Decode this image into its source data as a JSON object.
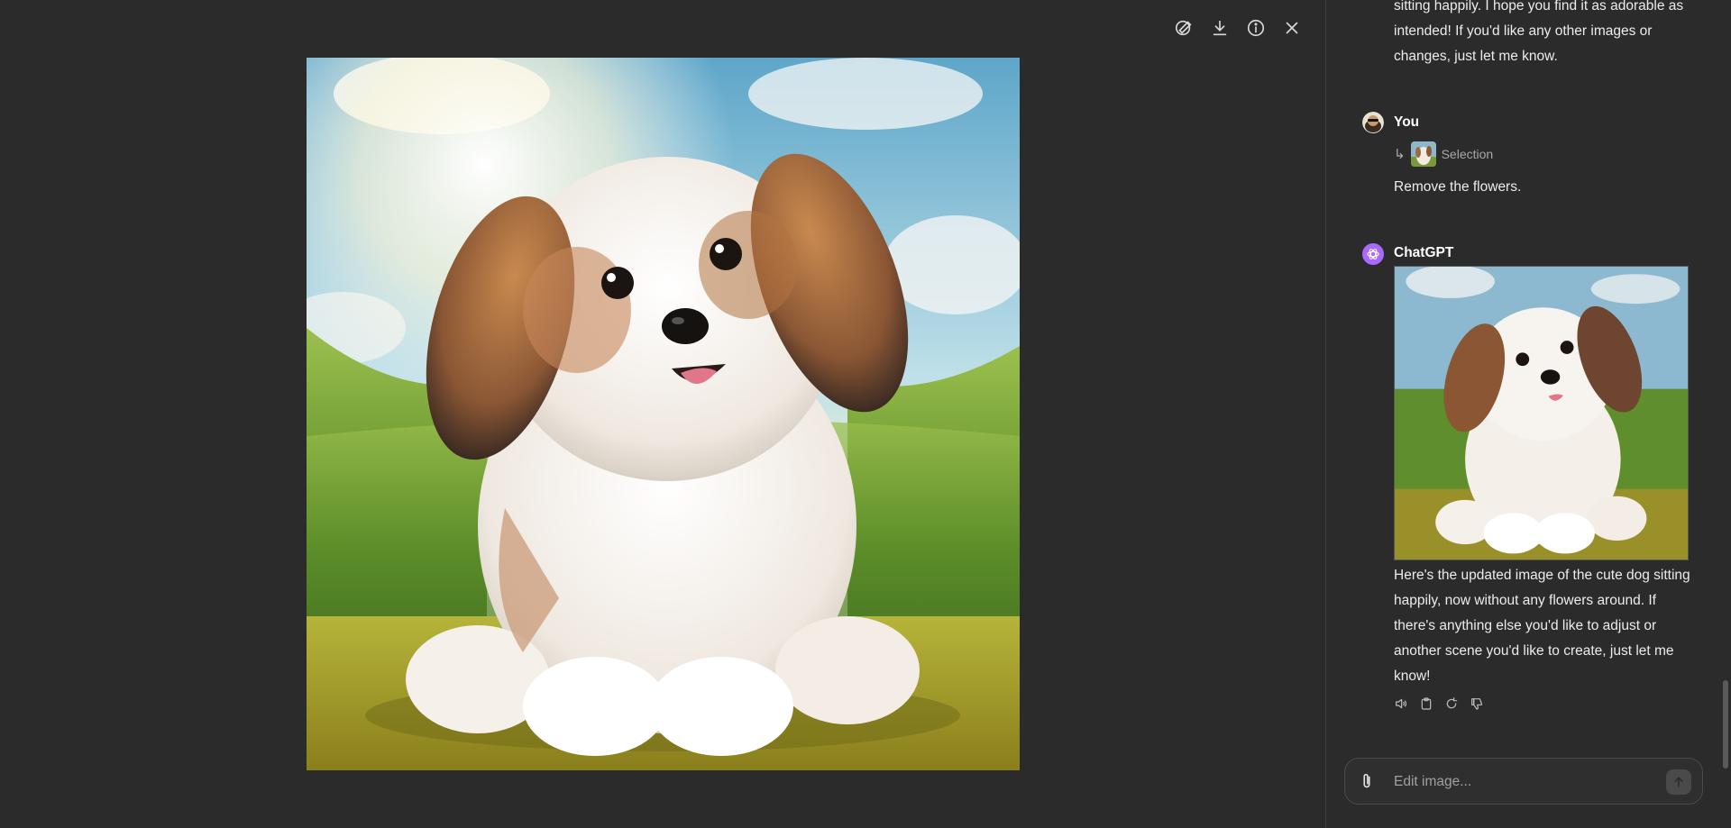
{
  "toolbar": {
    "icons": [
      "select-edit-icon",
      "download-icon",
      "info-icon",
      "close-icon"
    ]
  },
  "chat": {
    "previous_reply_tail": "sitting happily. I hope you find it as adorable as intended! If you'd like any other images or changes, just let me know.",
    "user": {
      "name": "You",
      "selection_label": "Selection",
      "message": "Remove the flowers."
    },
    "assistant": {
      "name": "ChatGPT",
      "message": "Here's the updated image of the cute dog sitting happily, now without any flowers around. If there's anything else you'd like to adjust or another scene you'd like to create, just let me know!"
    },
    "composer": {
      "placeholder": "Edit image..."
    }
  },
  "colors": {
    "background": "#2b2b2b",
    "text": "#ececec",
    "chatgpt_avatar": "#ab68ff"
  }
}
